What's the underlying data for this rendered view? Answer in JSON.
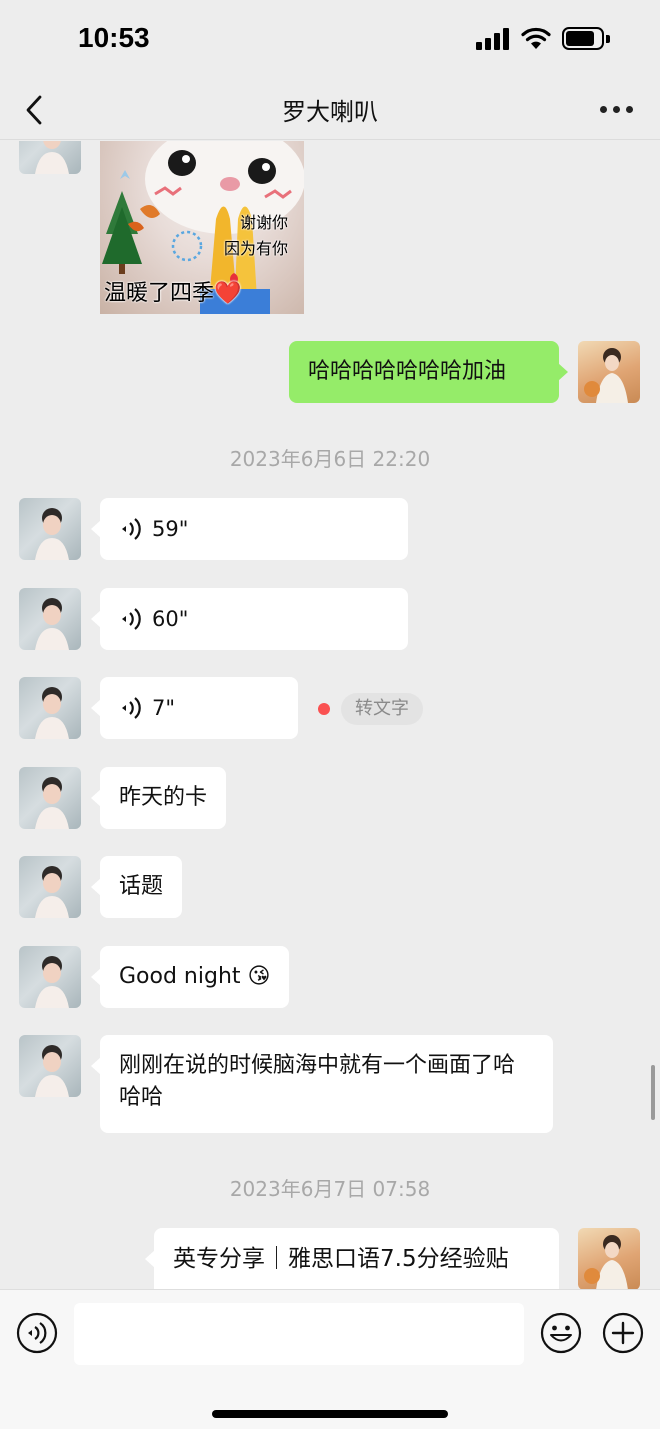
{
  "status_bar": {
    "time": "10:53"
  },
  "nav": {
    "title": "罗大喇叭"
  },
  "sticker": {
    "line1": "谢谢你",
    "line2": "因为有你",
    "line3": "温暖了四季❤️"
  },
  "messages": {
    "sent_cheer": "哈哈哈哈哈哈哈加油",
    "timestamp_1": "2023年6月6日 22:20",
    "voice_1": "59\"",
    "voice_2": "60\"",
    "voice_3": "7\"",
    "voice_3_convert": "转文字",
    "text_1": "昨天的卡",
    "text_2": "话题",
    "text_3": "Good night 😘",
    "text_4": "刚刚在说的时候脑海中就有一个画面了哈哈哈",
    "timestamp_2": "2023年6月7日 07:58",
    "shared_card_title": "英专分享｜雅思口语7.5分经验贴"
  },
  "input_bar": {
    "placeholder": ""
  },
  "colors": {
    "sent_bubble": "#95ec69",
    "received_bubble": "#ffffff",
    "background": "#ededed",
    "unread_dot": "#fa5151"
  }
}
